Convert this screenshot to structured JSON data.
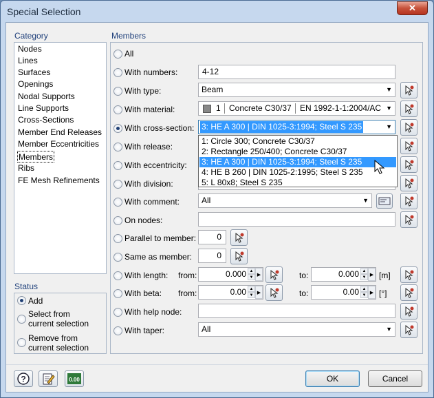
{
  "window": {
    "title": "Special Selection",
    "close_label": "✕"
  },
  "category": {
    "title": "Category",
    "items": [
      "Nodes",
      "Lines",
      "Surfaces",
      "Openings",
      "Nodal Supports",
      "Line Supports",
      "Cross-Sections",
      "Member End Releases",
      "Member Eccentricities",
      "Members",
      "Ribs",
      "FE Mesh Refinements"
    ],
    "selected": "Members"
  },
  "status": {
    "title": "Status",
    "add": "Add",
    "select_from_1": "Select from",
    "select_from_2": "current selection",
    "remove_from_1": "Remove from",
    "remove_from_2": "current selection"
  },
  "members": {
    "title": "Members",
    "all": "All",
    "with_numbers": {
      "label": "With numbers:",
      "value": "4-12"
    },
    "with_type": {
      "label": "With type:",
      "value": "Beam"
    },
    "with_material": {
      "label": "With material:",
      "number": "1",
      "name": "Concrete C30/37",
      "standard": "EN 1992-1-1:2004/AC"
    },
    "with_cross_section": {
      "label": "With cross-section:",
      "value": "3: HE A 300 | DIN 1025-3:1994; Steel S 235",
      "options": [
        "1: Circle 300; Concrete C30/37",
        "2: Rectangle 250/400; Concrete C30/37",
        "3: HE A 300 | DIN 1025-3:1994; Steel S 235",
        "4: HE B 260 | DIN 1025-2:1995; Steel S 235",
        "5: L 80x8; Steel S 235"
      ],
      "highlighted": "3: HE A 300 | DIN 1025-3:1994; Steel S 235"
    },
    "with_release": {
      "label": "With release:"
    },
    "with_eccentricity": {
      "label": "With eccentricity:"
    },
    "with_division": {
      "label": "With division:"
    },
    "with_comment": {
      "label": "With comment:",
      "value": "All"
    },
    "on_nodes": {
      "label": "On nodes:"
    },
    "parallel_to_member": {
      "label": "Parallel to member:",
      "value": "0"
    },
    "same_as_member": {
      "label": "Same as member:",
      "value": "0"
    },
    "with_length": {
      "label": "With length:",
      "from_label": "from:",
      "from_value": "0.000",
      "to_label": "to:",
      "to_value": "0.000",
      "unit": "[m]"
    },
    "with_beta": {
      "label": "With beta:",
      "from_label": "from:",
      "from_value": "0.00",
      "to_label": "to:",
      "to_value": "0.00",
      "unit": "[°]"
    },
    "with_help_node": {
      "label": "With help node:"
    },
    "with_taper": {
      "label": "With taper:",
      "value": "All"
    }
  },
  "buttons": {
    "ok": "OK",
    "cancel": "Cancel"
  },
  "bottom_icons": [
    "help-icon",
    "edit-icon",
    "units-icon"
  ],
  "units_icon_text": "0.00",
  "colors": {
    "highlight": "#3399ff",
    "title_blue": "#1e3f7a",
    "frame_bg": "#c6d8ee"
  }
}
